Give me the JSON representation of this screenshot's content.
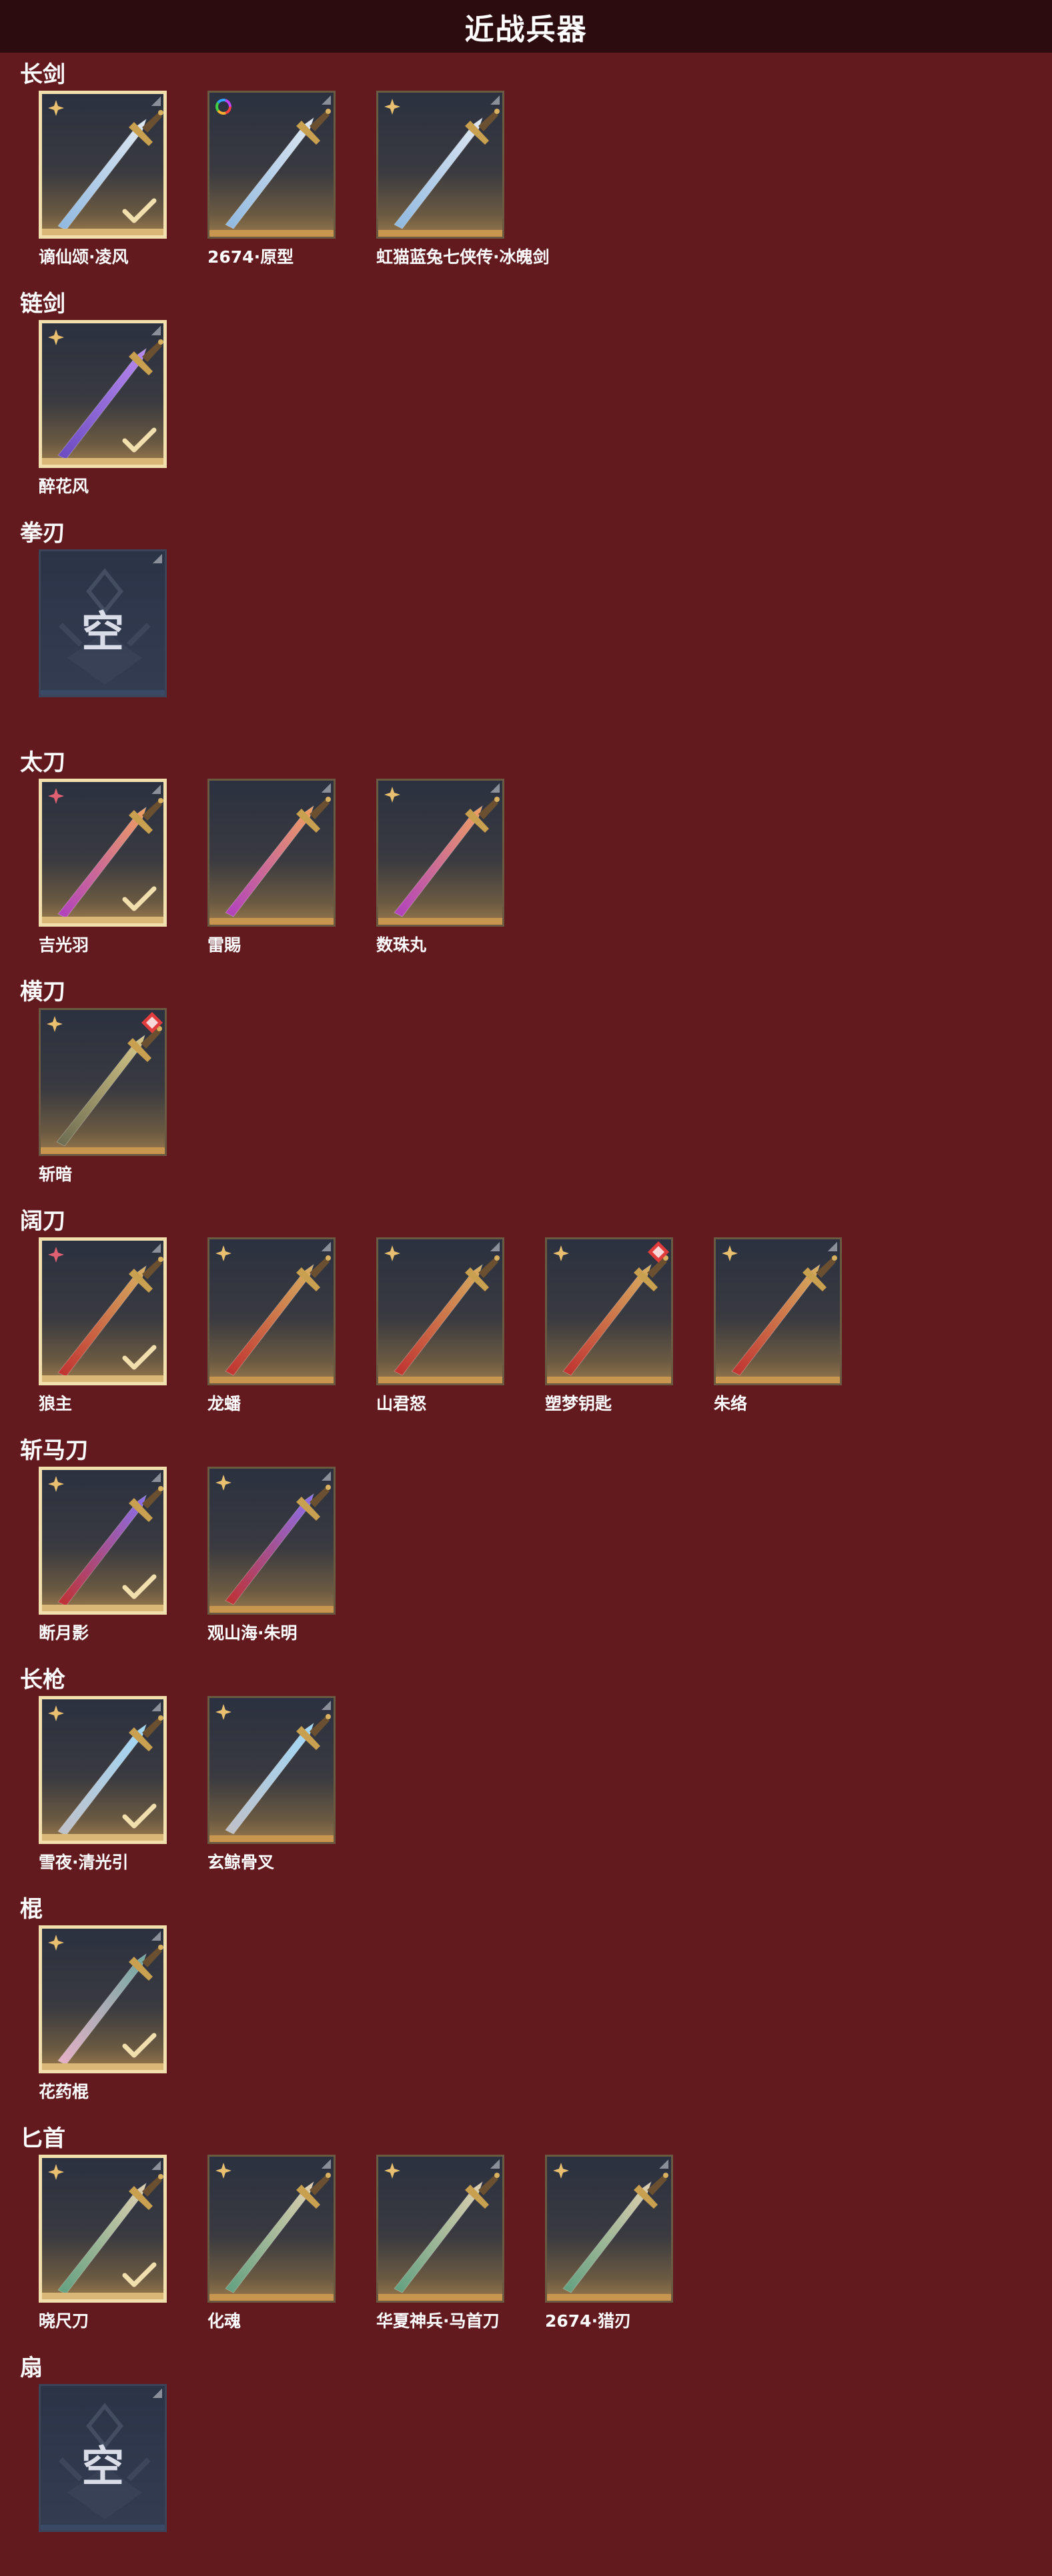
{
  "header": {
    "title": "近战兵器"
  },
  "empty_glyph": "空",
  "colors": {
    "background": "#621a1f",
    "header": "#2d0c10",
    "selected_border": "#f2dfae",
    "card_gold": "#c8964f"
  },
  "categories": [
    {
      "label": "长剑",
      "items": [
        {
          "name": "谪仙颂·凌风",
          "selected": true,
          "icon": "gold-star-icon",
          "art": "sword"
        },
        {
          "name": "2674·原型",
          "selected": false,
          "icon": "rainbow-ring-icon",
          "art": "sword"
        },
        {
          "name": "虹猫蓝兔七侠传·冰魄剑",
          "selected": false,
          "icon": "gold-star-icon",
          "art": "sword"
        }
      ]
    },
    {
      "label": "链剑",
      "items": [
        {
          "name": "醉花风",
          "selected": true,
          "icon": "gold-star-icon",
          "art": "chain-sword"
        }
      ]
    },
    {
      "label": "拳刃",
      "items": [
        {
          "name": "",
          "empty": true
        }
      ]
    },
    {
      "label": "太刀",
      "items": [
        {
          "name": "吉光羽",
          "selected": true,
          "icon": "red-star-icon",
          "art": "katana"
        },
        {
          "name": "雷賜",
          "selected": false,
          "icon": "none",
          "art": "katana"
        },
        {
          "name": "数珠丸",
          "selected": false,
          "icon": "gold-star-icon",
          "art": "katana"
        }
      ]
    },
    {
      "label": "横刀",
      "items": [
        {
          "name": "斩暗",
          "selected": false,
          "icon": "gold-star-icon",
          "badge": "red-diamond-icon",
          "art": "sabre"
        }
      ]
    },
    {
      "label": "阔刀",
      "items": [
        {
          "name": "狼主",
          "selected": true,
          "icon": "red-star-icon",
          "art": "broadblade"
        },
        {
          "name": "龙蟠",
          "selected": false,
          "icon": "gold-star-icon",
          "art": "broadblade"
        },
        {
          "name": "山君怒",
          "selected": false,
          "icon": "gold-star-icon",
          "art": "broadblade"
        },
        {
          "name": "塑梦钥匙",
          "selected": false,
          "icon": "gold-star-icon",
          "badge": "red-diamond-icon",
          "art": "broadblade"
        },
        {
          "name": "朱络",
          "selected": false,
          "icon": "gold-star-icon",
          "art": "broadblade"
        }
      ]
    },
    {
      "label": "斩马刀",
      "items": [
        {
          "name": "断月影",
          "selected": true,
          "icon": "gold-star-icon",
          "art": "glaive"
        },
        {
          "name": "观山海·朱明",
          "selected": false,
          "icon": "gold-star-icon",
          "art": "glaive"
        }
      ]
    },
    {
      "label": "长枪",
      "items": [
        {
          "name": "雪夜·清光引",
          "selected": true,
          "icon": "gold-star-icon",
          "art": "spear"
        },
        {
          "name": "玄鲸骨叉",
          "selected": false,
          "icon": "gold-star-icon",
          "art": "spear"
        }
      ]
    },
    {
      "label": "棍",
      "items": [
        {
          "name": "花药棍",
          "selected": true,
          "icon": "gold-star-icon",
          "art": "staff"
        }
      ]
    },
    {
      "label": "匕首",
      "items": [
        {
          "name": "晓尺刀",
          "selected": true,
          "icon": "gold-star-icon",
          "art": "dagger"
        },
        {
          "name": "化魂",
          "selected": false,
          "icon": "gold-star-icon",
          "art": "dagger"
        },
        {
          "name": "华夏神兵·马首刀",
          "selected": false,
          "icon": "gold-star-icon",
          "art": "dagger"
        },
        {
          "name": "2674·猎刃",
          "selected": false,
          "icon": "gold-star-icon",
          "art": "dagger"
        }
      ]
    },
    {
      "label": "扇",
      "items": [
        {
          "name": "",
          "empty": true
        }
      ]
    }
  ]
}
